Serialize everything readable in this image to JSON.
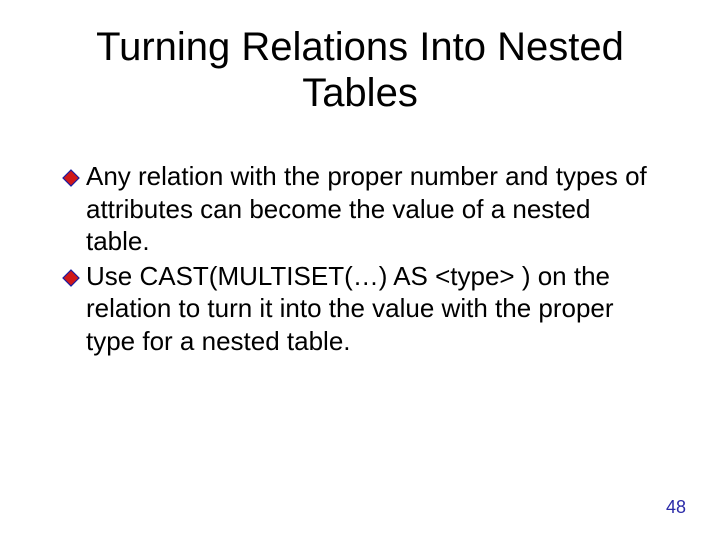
{
  "title": "Turning Relations Into Nested Tables",
  "bullets": [
    {
      "text": "Any relation with the proper number and types of attributes can become the value of a nested table."
    },
    {
      "text": "Use CAST(MULTISET(…) AS <type> ) on the relation to turn it into the value with the proper type for a nested table."
    }
  ],
  "pageNumber": "48",
  "colors": {
    "bulletFill": "#d01818",
    "bulletStroke": "#1a1aa0"
  }
}
